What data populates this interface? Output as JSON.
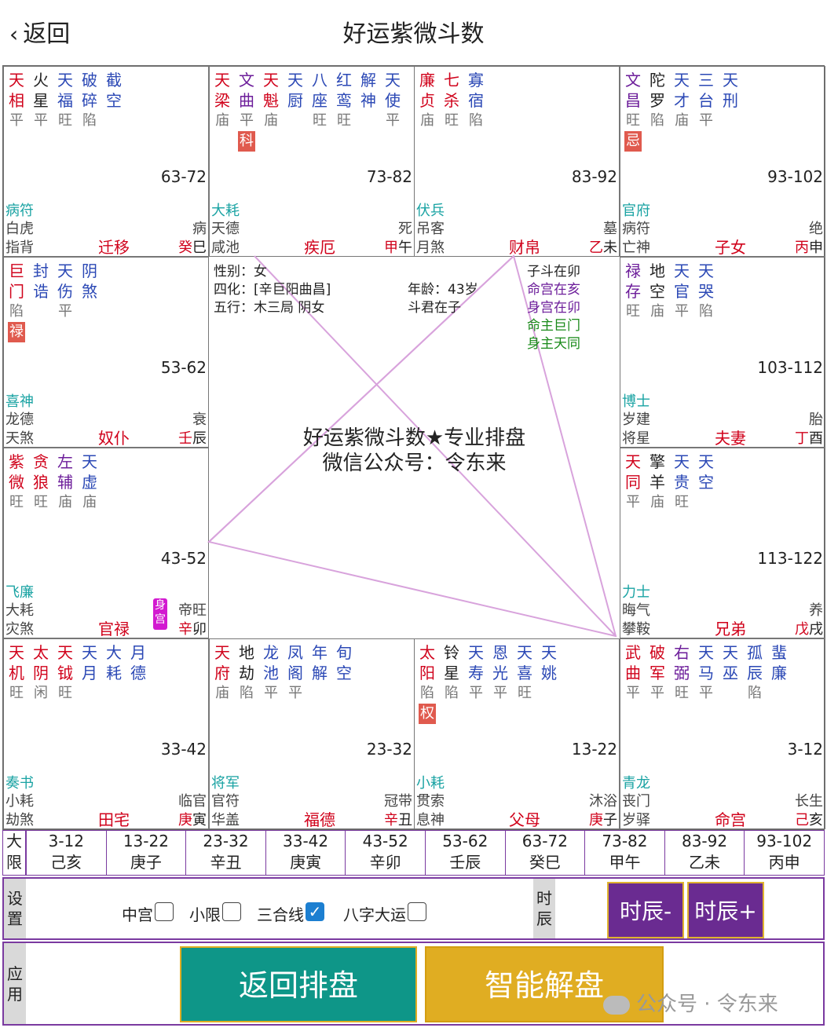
{
  "header": {
    "back_label": "返回",
    "title": "好运紫微斗数"
  },
  "palaces": [
    {
      "stars": [
        {
          "n": "天相",
          "b": "平",
          "c": "red"
        },
        {
          "n": "火星",
          "b": "平",
          "c": "dark"
        },
        {
          "n": "天福",
          "b": "旺",
          "c": "blue"
        },
        {
          "n": "破碎",
          "b": "陷",
          "c": "blue"
        },
        {
          "n": "截空",
          "b": "",
          "c": "blue"
        }
      ],
      "hua": "",
      "age": "63-72",
      "g1": "病符",
      "g2": "白虎",
      "g3": "指背",
      "life": "病",
      "palace": "迁移",
      "stem": "癸",
      "branch": "巳",
      "shen": ""
    },
    {
      "stars": [
        {
          "n": "天梁",
          "b": "庙",
          "c": "red"
        },
        {
          "n": "文曲",
          "b": "平",
          "c": "purple"
        },
        {
          "n": "天魁",
          "b": "庙",
          "c": "red"
        },
        {
          "n": "天厨",
          "b": "",
          "c": "blue"
        },
        {
          "n": "八座",
          "b": "旺",
          "c": "blue"
        },
        {
          "n": "红鸾",
          "b": "旺",
          "c": "blue"
        },
        {
          "n": "解神",
          "b": "",
          "c": "blue"
        },
        {
          "n": "天使",
          "b": "平",
          "c": "blue"
        }
      ],
      "hua": "科",
      "hua_idx": 1,
      "age": "73-82",
      "g1": "大耗",
      "g2": "天德",
      "g3": "咸池",
      "life": "死",
      "palace": "疾厄",
      "stem": "甲",
      "branch": "午",
      "shen": ""
    },
    {
      "stars": [
        {
          "n": "廉贞",
          "b": "庙",
          "c": "red"
        },
        {
          "n": "七杀",
          "b": "旺",
          "c": "red"
        },
        {
          "n": "寡宿",
          "b": "陷",
          "c": "blue"
        }
      ],
      "hua": "",
      "age": "83-92",
      "g1": "伏兵",
      "g2": "吊客",
      "g3": "月煞",
      "life": "墓",
      "palace": "财帛",
      "stem": "乙",
      "branch": "未",
      "shen": ""
    },
    {
      "stars": [
        {
          "n": "文昌",
          "b": "旺",
          "c": "purple"
        },
        {
          "n": "陀罗",
          "b": "陷",
          "c": "dark"
        },
        {
          "n": "天才",
          "b": "庙",
          "c": "blue"
        },
        {
          "n": "三台",
          "b": "平",
          "c": "blue"
        },
        {
          "n": "天刑",
          "b": "",
          "c": "blue"
        }
      ],
      "hua": "忌",
      "hua_idx": 0,
      "age": "93-102",
      "g1": "官府",
      "g2": "病符",
      "g3": "亡神",
      "life": "绝",
      "palace": "子女",
      "stem": "丙",
      "branch": "申",
      "shen": ""
    },
    {
      "stars": [
        {
          "n": "巨门",
          "b": "陷",
          "c": "red"
        },
        {
          "n": "封诰",
          "b": "",
          "c": "blue"
        },
        {
          "n": "天伤",
          "b": "平",
          "c": "blue"
        },
        {
          "n": "阴煞",
          "b": "",
          "c": "blue"
        }
      ],
      "hua": "禄",
      "hua_idx": 0,
      "age": "53-62",
      "g1": "喜神",
      "g2": "龙德",
      "g3": "天煞",
      "life": "衰",
      "palace": "奴仆",
      "stem": "壬",
      "branch": "辰",
      "shen": ""
    },
    {
      "stars": [
        {
          "n": "禄存",
          "b": "旺",
          "c": "purple"
        },
        {
          "n": "地空",
          "b": "庙",
          "c": "dark"
        },
        {
          "n": "天官",
          "b": "平",
          "c": "blue"
        },
        {
          "n": "天哭",
          "b": "陷",
          "c": "blue"
        }
      ],
      "hua": "",
      "age": "103-112",
      "g1": "博士",
      "g2": "岁建",
      "g3": "将星",
      "life": "胎",
      "palace": "夫妻",
      "stem": "丁",
      "branch": "酉",
      "shen": ""
    },
    {
      "stars": [
        {
          "n": "紫微",
          "b": "旺",
          "c": "red"
        },
        {
          "n": "贪狼",
          "b": "旺",
          "c": "red"
        },
        {
          "n": "左辅",
          "b": "庙",
          "c": "purple"
        },
        {
          "n": "天虚",
          "b": "庙",
          "c": "blue"
        }
      ],
      "hua": "",
      "age": "43-52",
      "g1": "飞廉",
      "g2": "大耗",
      "g3": "灾煞",
      "life": "帝旺",
      "palace": "官禄",
      "stem": "辛",
      "branch": "卯",
      "shen": "身宫"
    },
    {
      "stars": [
        {
          "n": "天同",
          "b": "平",
          "c": "red"
        },
        {
          "n": "擎羊",
          "b": "庙",
          "c": "dark"
        },
        {
          "n": "天贵",
          "b": "旺",
          "c": "blue"
        },
        {
          "n": "天空",
          "b": "",
          "c": "blue"
        }
      ],
      "hua": "",
      "age": "113-122",
      "g1": "力士",
      "g2": "晦气",
      "g3": "攀鞍",
      "life": "养",
      "palace": "兄弟",
      "stem": "戊",
      "branch": "戌",
      "shen": ""
    },
    {
      "stars": [
        {
          "n": "天机",
          "b": "旺",
          "c": "red"
        },
        {
          "n": "太阴",
          "b": "闲",
          "c": "red"
        },
        {
          "n": "天钺",
          "b": "旺",
          "c": "red"
        },
        {
          "n": "天月",
          "b": "",
          "c": "blue"
        },
        {
          "n": "大耗",
          "b": "",
          "c": "blue"
        },
        {
          "n": "月德",
          "b": "",
          "c": "blue"
        }
      ],
      "hua": "",
      "age": "33-42",
      "g1": "奏书",
      "g2": "小耗",
      "g3": "劫煞",
      "life": "临官",
      "palace": "田宅",
      "stem": "庚",
      "branch": "寅",
      "shen": ""
    },
    {
      "stars": [
        {
          "n": "天府",
          "b": "庙",
          "c": "red"
        },
        {
          "n": "地劫",
          "b": "陷",
          "c": "dark"
        },
        {
          "n": "龙池",
          "b": "平",
          "c": "blue"
        },
        {
          "n": "凤阁",
          "b": "平",
          "c": "blue"
        },
        {
          "n": "年解",
          "b": "",
          "c": "blue"
        },
        {
          "n": "旬空",
          "b": "",
          "c": "blue"
        }
      ],
      "hua": "",
      "age": "23-32",
      "g1": "将军",
      "g2": "官符",
      "g3": "华盖",
      "life": "冠带",
      "palace": "福德",
      "stem": "辛",
      "branch": "丑",
      "shen": ""
    },
    {
      "stars": [
        {
          "n": "太阳",
          "b": "陷",
          "c": "red"
        },
        {
          "n": "铃星",
          "b": "陷",
          "c": "dark"
        },
        {
          "n": "天寿",
          "b": "平",
          "c": "blue"
        },
        {
          "n": "恩光",
          "b": "平",
          "c": "blue"
        },
        {
          "n": "天喜",
          "b": "旺",
          "c": "blue"
        },
        {
          "n": "天姚",
          "b": "",
          "c": "blue"
        }
      ],
      "hua": "权",
      "hua_idx": 0,
      "age": "13-22",
      "g1": "小耗",
      "g2": "贯索",
      "g3": "息神",
      "life": "沐浴",
      "palace": "父母",
      "stem": "庚",
      "branch": "子",
      "shen": ""
    },
    {
      "stars": [
        {
          "n": "武曲",
          "b": "平",
          "c": "red"
        },
        {
          "n": "破军",
          "b": "平",
          "c": "red"
        },
        {
          "n": "右弼",
          "b": "旺",
          "c": "purple"
        },
        {
          "n": "天马",
          "b": "平",
          "c": "blue"
        },
        {
          "n": "天巫",
          "b": "",
          "c": "blue"
        },
        {
          "n": "孤辰",
          "b": "陷",
          "c": "blue"
        },
        {
          "n": "蜚廉",
          "b": "",
          "c": "blue"
        }
      ],
      "hua": "",
      "age": "3-12",
      "g1": "青龙",
      "g2": "丧门",
      "g3": "岁驿",
      "life": "长生",
      "palace": "命宫",
      "stem": "己",
      "branch": "亥",
      "shen": ""
    }
  ],
  "center": {
    "gender": "性别：女",
    "sihua": "四化：[辛巨阳曲昌]",
    "wuxing": "五行：木三局 阴女",
    "age": "年龄：43岁",
    "doujun": "斗君在子",
    "zidou": "子斗在卯",
    "minggong": "命宫在亥",
    "shengong": "身宫在卯",
    "mingzhu": "命主巨门",
    "shenzhu": "身主天同",
    "watermark1": "好运紫微斗数★专业排盘",
    "watermark2": "微信公众号：令东来"
  },
  "daxian": {
    "header": "大限",
    "items": [
      [
        "3-12",
        "己亥"
      ],
      [
        "13-22",
        "庚子"
      ],
      [
        "23-32",
        "辛丑"
      ],
      [
        "33-42",
        "庚寅"
      ],
      [
        "43-52",
        "辛卯"
      ],
      [
        "53-62",
        "壬辰"
      ],
      [
        "63-72",
        "癸巳"
      ],
      [
        "73-82",
        "甲午"
      ],
      [
        "83-92",
        "乙未"
      ],
      [
        "93-102",
        "丙申"
      ]
    ]
  },
  "settings": {
    "label": "设置",
    "opts": [
      "中宫",
      "小限",
      "三合线",
      "八字大运"
    ],
    "checked": [
      false,
      false,
      true,
      false
    ],
    "shichen_label": "时辰",
    "minus": "时辰-",
    "plus": "时辰+"
  },
  "apps": {
    "label": "应用",
    "back": "返回排盘",
    "smart": "智能解盘"
  },
  "wechat_mark": "公众号 · 令东来",
  "colors": {
    "red": "#d0021b",
    "blue": "#2b48b5",
    "purple": "#6c1d9a",
    "teal": "#1aa3a3",
    "green": "#1a8a1a",
    "accent": "#7a3aa0",
    "btn_teal": "#0e9688",
    "btn_gold": "#e0ad22"
  }
}
